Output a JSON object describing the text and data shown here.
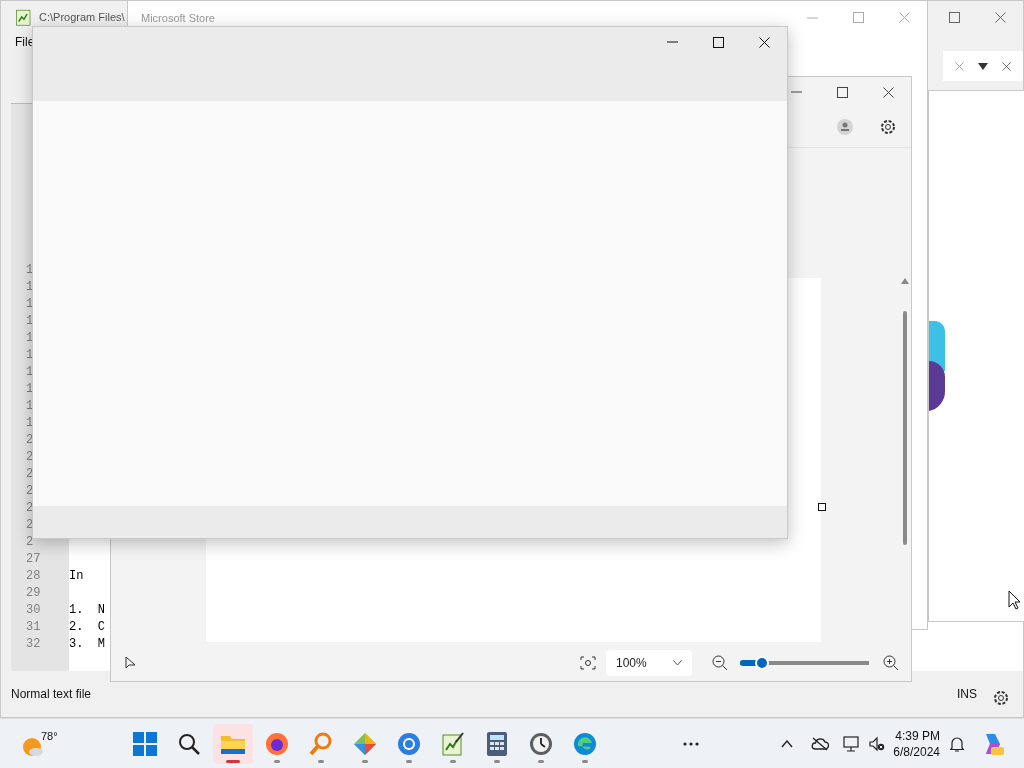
{
  "editor_window": {
    "title": "C:\\Program Files\\",
    "menu": [
      "File"
    ],
    "line_numbers": [
      "1",
      "1",
      "1",
      "1",
      "1",
      "1",
      "1",
      "1",
      "1",
      "1",
      "2",
      "2",
      "2",
      "2",
      "2",
      "2",
      "2"
    ],
    "lines": [
      {
        "number": "27"
      },
      {
        "number": "28",
        "text": "In"
      },
      {
        "number": "29"
      },
      {
        "number": "30",
        "text": "1.  N"
      },
      {
        "number": "31",
        "text": "2.  C"
      },
      {
        "number": "32",
        "text": "3.  M"
      }
    ],
    "status_left": "Normal text file",
    "status_right": "INS"
  },
  "store_window": {
    "title": "Microsoft Store"
  },
  "photos_window": {
    "zoom": "100%",
    "zoom_slider": {
      "level": 0.17
    }
  },
  "taskbar": {
    "weather": "78°",
    "apps": [
      {
        "kind": "start",
        "running": false,
        "active": false
      },
      {
        "kind": "search",
        "running": false,
        "active": false
      },
      {
        "kind": "folder",
        "running": true,
        "active": true
      },
      {
        "kind": "firefox",
        "running": true,
        "active": false
      },
      {
        "kind": "magnifier",
        "running": true,
        "active": false
      },
      {
        "kind": "diamond",
        "running": true,
        "active": false
      },
      {
        "kind": "chrome",
        "running": true,
        "active": false
      },
      {
        "kind": "notepad",
        "running": true,
        "active": false
      },
      {
        "kind": "calculator",
        "running": true,
        "active": false
      },
      {
        "kind": "clock",
        "running": true,
        "active": false
      },
      {
        "kind": "edge",
        "running": true,
        "active": false
      }
    ],
    "time": "4:39 PM",
    "date": "6/8/2024"
  }
}
